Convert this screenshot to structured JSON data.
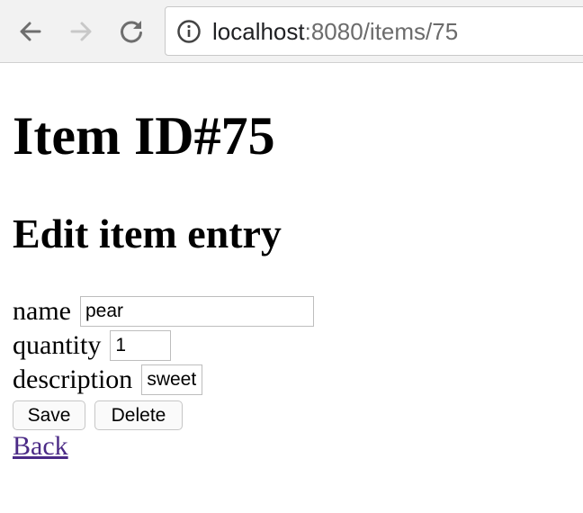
{
  "browser": {
    "url_host": "localhost",
    "url_rest": ":8080/items/75",
    "icons": {
      "back": "arrow-left-icon",
      "forward": "arrow-right-icon",
      "reload": "reload-icon",
      "info": "info-icon"
    }
  },
  "page": {
    "title": "Item ID#75",
    "subtitle": "Edit item entry",
    "form": {
      "name_label": "name",
      "name_value": "pear",
      "quantity_label": "quantity",
      "quantity_value": "1",
      "description_label": "description",
      "description_value": "sweet"
    },
    "buttons": {
      "save": "Save",
      "delete": "Delete"
    },
    "back_link": "Back"
  },
  "colors": {
    "link_visited": "#4b2a86",
    "toolbar_bg": "#f2f2f2"
  }
}
